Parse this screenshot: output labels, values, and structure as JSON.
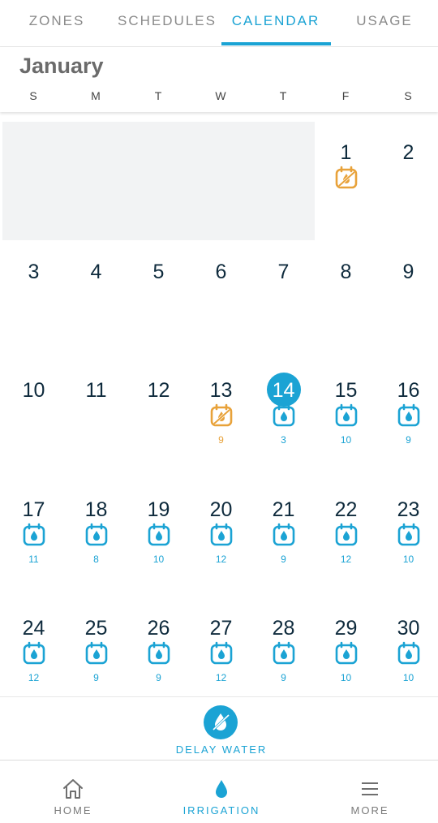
{
  "tabs": [
    {
      "label": "ZONES",
      "active": false
    },
    {
      "label": "SCHEDULES",
      "active": false
    },
    {
      "label": "CALENDAR",
      "active": true
    },
    {
      "label": "USAGE",
      "active": false
    }
  ],
  "month": "January",
  "weekdays": [
    "S",
    "M",
    "T",
    "W",
    "T",
    "F",
    "S"
  ],
  "first_weekday_index": 5,
  "today": 14,
  "days": [
    {
      "day": "1",
      "event": "skip",
      "count": ""
    },
    {
      "day": "2",
      "event": "",
      "count": ""
    },
    {
      "day": "3",
      "event": "",
      "count": ""
    },
    {
      "day": "4",
      "event": "",
      "count": ""
    },
    {
      "day": "5",
      "event": "",
      "count": ""
    },
    {
      "day": "6",
      "event": "",
      "count": ""
    },
    {
      "day": "7",
      "event": "",
      "count": ""
    },
    {
      "day": "8",
      "event": "",
      "count": ""
    },
    {
      "day": "9",
      "event": "",
      "count": ""
    },
    {
      "day": "10",
      "event": "",
      "count": ""
    },
    {
      "day": "11",
      "event": "",
      "count": ""
    },
    {
      "day": "12",
      "event": "",
      "count": ""
    },
    {
      "day": "13",
      "event": "skip",
      "count": "9"
    },
    {
      "day": "14",
      "event": "water",
      "count": "3"
    },
    {
      "day": "15",
      "event": "water",
      "count": "10"
    },
    {
      "day": "16",
      "event": "water",
      "count": "9"
    },
    {
      "day": "17",
      "event": "water",
      "count": "11"
    },
    {
      "day": "18",
      "event": "water",
      "count": "8"
    },
    {
      "day": "19",
      "event": "water",
      "count": "10"
    },
    {
      "day": "20",
      "event": "water",
      "count": "12"
    },
    {
      "day": "21",
      "event": "water",
      "count": "9"
    },
    {
      "day": "22",
      "event": "water",
      "count": "12"
    },
    {
      "day": "23",
      "event": "water",
      "count": "10"
    },
    {
      "day": "24",
      "event": "water",
      "count": "12"
    },
    {
      "day": "25",
      "event": "water",
      "count": "9"
    },
    {
      "day": "26",
      "event": "water",
      "count": "9"
    },
    {
      "day": "27",
      "event": "water",
      "count": "12"
    },
    {
      "day": "28",
      "event": "water",
      "count": "9"
    },
    {
      "day": "29",
      "event": "water",
      "count": "10"
    },
    {
      "day": "30",
      "event": "water",
      "count": "10"
    }
  ],
  "delay_water": {
    "label": "DELAY WATER",
    "icon": "no-water-icon"
  },
  "bottom_nav": [
    {
      "label": "HOME",
      "icon": "home-icon",
      "active": false
    },
    {
      "label": "IRRIGATION",
      "icon": "water-drop-icon",
      "active": true
    },
    {
      "label": "MORE",
      "icon": "menu-icon",
      "active": false
    }
  ],
  "colors": {
    "accent": "#1ba3d4",
    "skip": "#e8a23a",
    "text": "#0f2b3d"
  }
}
